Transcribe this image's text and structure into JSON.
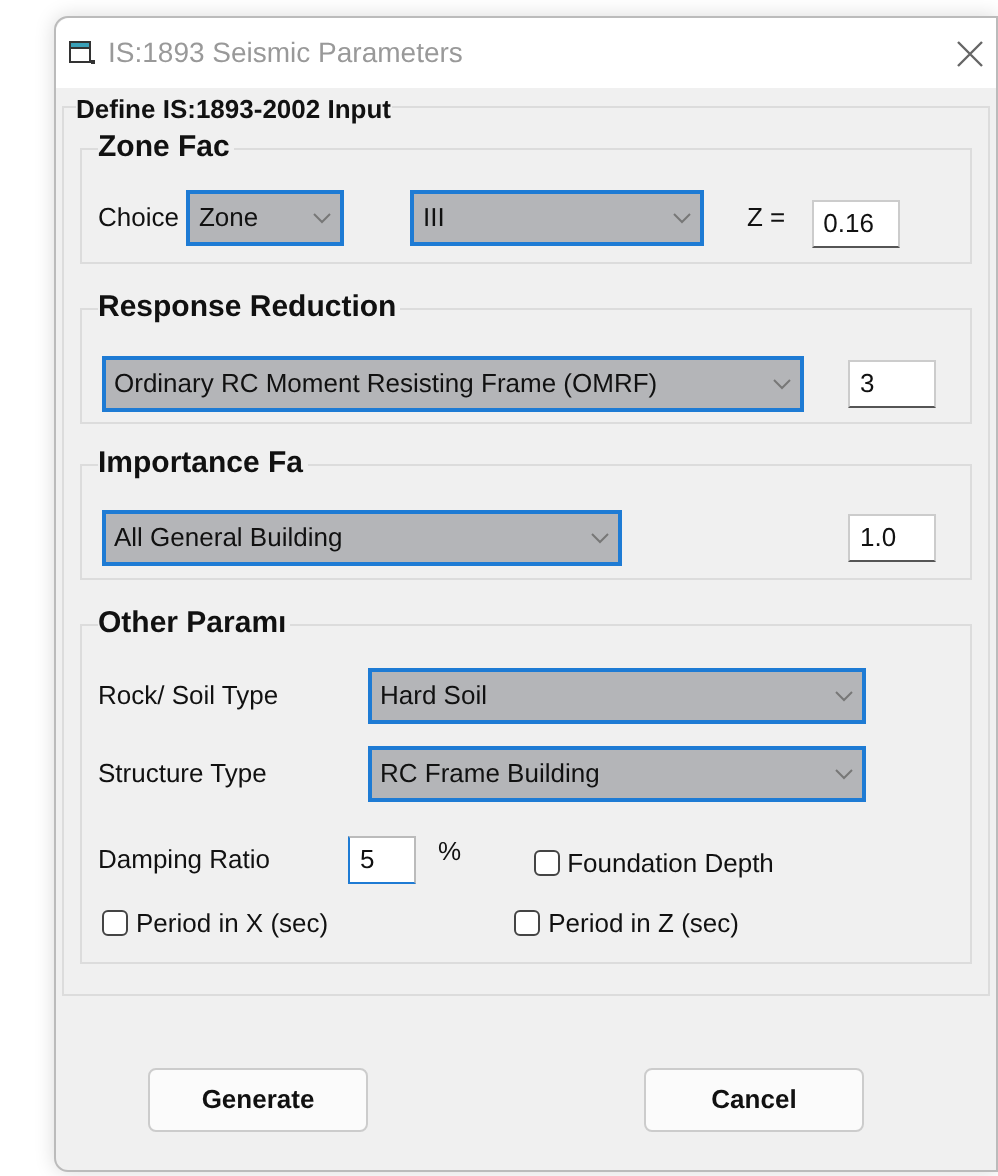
{
  "window": {
    "title": "IS:1893 Seismic Parameters"
  },
  "heading": "Define IS:1893-2002 Input",
  "zone_factor": {
    "title": "Zone Fac",
    "choice_label": "Choice",
    "choice": "Zone",
    "zone": "III",
    "z_label": "Z =",
    "z_value": "0.16"
  },
  "response_reduction": {
    "title": "Response Reduction",
    "frame_type": "Ordinary RC Moment Resisting Frame (OMRF)",
    "value": "3"
  },
  "importance_factor": {
    "title": "Importance Fa",
    "building": "All General Building",
    "value": "1.0"
  },
  "other_parameters": {
    "title": "Other Paramı",
    "soil_label": "Rock/ Soil Type",
    "soil": "Hard Soil",
    "structure_label": "Structure Type",
    "structure": "RC Frame Building",
    "damping_label": "Damping Ratio",
    "damping": "5",
    "damping_unit": "%",
    "checkboxes": [
      {
        "label": "Foundation Depth",
        "checked": false
      },
      {
        "label": "Period in X (sec)",
        "checked": false
      },
      {
        "label": "Period in Z (sec)",
        "checked": false
      }
    ]
  },
  "buttons": [
    "Generate",
    "Cancel"
  ]
}
